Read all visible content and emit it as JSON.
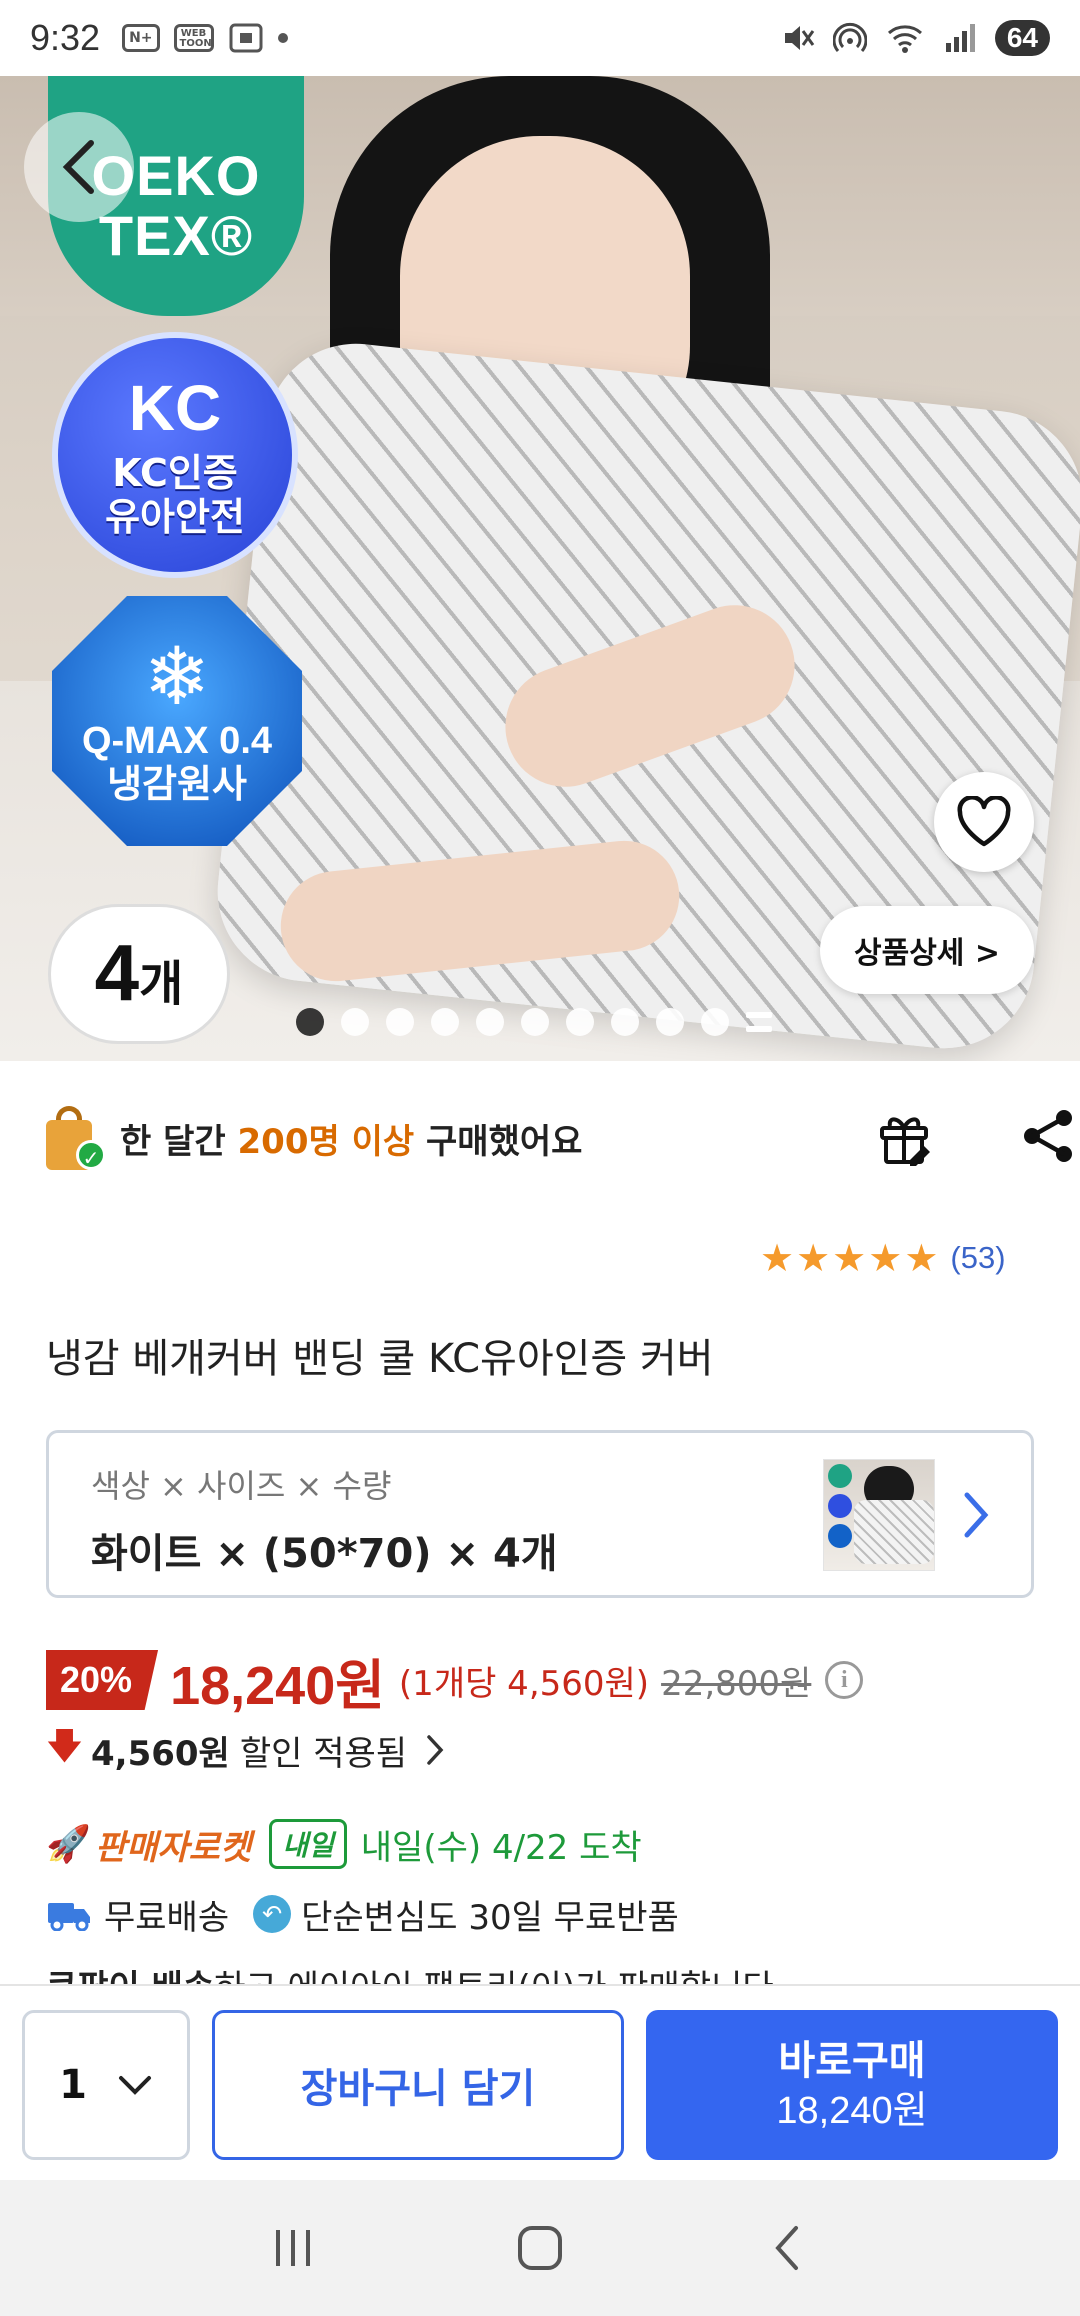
{
  "status_bar": {
    "time": "9:32",
    "badges": [
      "N+",
      "WEB TOON"
    ],
    "battery": "64"
  },
  "hero": {
    "oeko_line1": "OEKO",
    "oeko_line2": "TEX®",
    "kc_logo": "KC",
    "kc_line1": "KC인증",
    "kc_line2": "유아안전",
    "qmax_line1": "Q-MAX 0.4",
    "qmax_line2": "냉감원사",
    "qty_number": "4",
    "qty_unit": "개",
    "detail_button": "상품상세 >",
    "slide_count": 10,
    "active_slide": 0
  },
  "purchase_banner": {
    "prefix": "한 달간 ",
    "highlight": "200명 이상",
    "suffix": " 구매했어요"
  },
  "rating": {
    "stars": 5,
    "count": "(53)"
  },
  "product_title": "냉감 베개커버 밴딩 쿨 KC유아인증 커버",
  "option": {
    "label": "색상 × 사이즈 × 수량",
    "value": "화이트 × (50*70) × 4개"
  },
  "price": {
    "discount_rate": "20%",
    "sale_price": "18,240원",
    "unit_price": "(1개당 4,560원)",
    "original_price": "22,800원"
  },
  "discount": {
    "amount": "4,560원",
    "label": "할인 적용됨"
  },
  "delivery": {
    "rocket_label": "판매자로켓",
    "tomorrow_chip": "내일",
    "arrival": "내일(수) 4/22 도착",
    "free_shipping": "무료배송",
    "free_return": "단순변심도 30일 무료반품",
    "seller_bold": "쿠팡이 배송",
    "seller_rest": "하고 에이아이 팩토리(이)가 판매합니다"
  },
  "bottom_bar": {
    "quantity": "1",
    "cart_label": "장바구니 담기",
    "buy_label": "바로구매",
    "buy_price": "18,240원"
  },
  "colors": {
    "accent_blue": "#3466f0",
    "price_red": "#c7281a",
    "highlight_orange": "#d86a00",
    "delivery_green": "#1d9a3a",
    "star_orange": "#f59a2c"
  }
}
